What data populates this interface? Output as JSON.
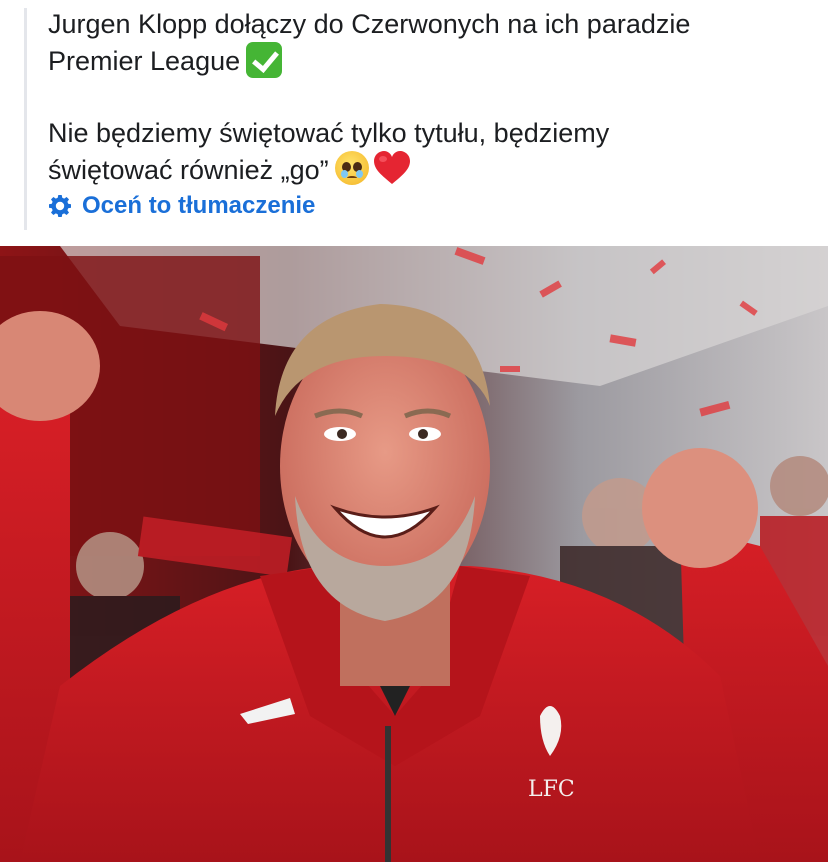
{
  "post": {
    "line1": "Jurgen Klopp dołączy do Czerwonych na ich paradzie",
    "line2": "Premier League",
    "line3": "Nie będziemy świętować tylko tytułu, będziemy",
    "line4": "świętować również „go”",
    "emoji_line2": "check-mark-emoji",
    "emoji_line4": [
      "teary-smile-emoji",
      "red-heart-emoji"
    ],
    "rate_translation_label": "Oceń to tłumaczenie",
    "rate_icon": "gear-icon"
  },
  "photo": {
    "subject": "smiling man in red zip jacket with raised fists at a parade",
    "logo_text": "LFC"
  },
  "colors": {
    "link_blue": "#1a6fd8",
    "jacket_red": "#c8161f",
    "quote_bar": "#e4e6eb"
  }
}
